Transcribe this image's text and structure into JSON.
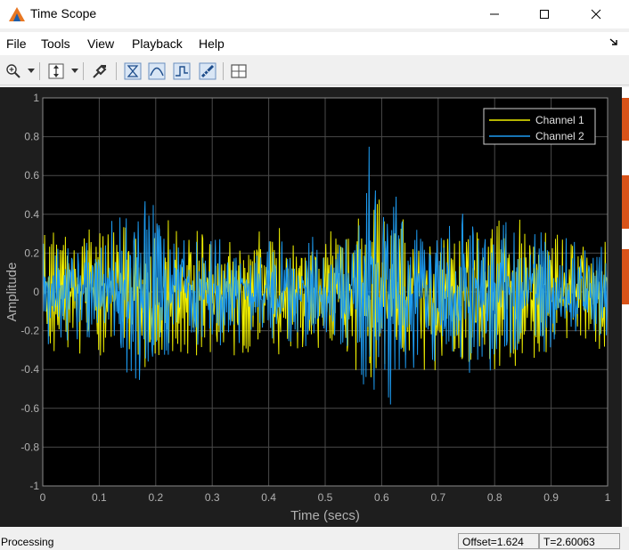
{
  "window": {
    "title": "Time Scope",
    "controls": [
      "minimize",
      "maximize",
      "close"
    ]
  },
  "menu": {
    "items": [
      "File",
      "Tools",
      "View",
      "Playback",
      "Help"
    ]
  },
  "toolbar": {
    "icons": [
      "zoom-in-icon",
      "scale-axes-icon",
      "configuration-properties-icon",
      "trigger-triggers-icon",
      "cursor-measurements-icon",
      "signal-statistics-icon",
      "peak-finder-icon",
      "layout-icon"
    ]
  },
  "scope": {
    "colors": {
      "background": "#000000",
      "figure": "#1e1e1e",
      "grid": "#4a4a4a",
      "axis_text": "#b0b0b0",
      "channel1": "#f0f000",
      "channel2": "#1d9bf0"
    }
  },
  "chart_data": {
    "type": "line",
    "xlabel": "Time (secs)",
    "ylabel": "Amplitude",
    "xlim": [
      0,
      1
    ],
    "ylim": [
      -1,
      1
    ],
    "xticks": [
      "0",
      "0.1",
      "0.2",
      "0.3",
      "0.4",
      "0.5",
      "0.6",
      "0.7",
      "0.8",
      "0.9",
      "1"
    ],
    "yticks": [
      "1",
      "0.8",
      "0.6",
      "0.4",
      "0.2",
      "0",
      "-0.2",
      "-0.4",
      "-0.6",
      "-0.8",
      "-1"
    ],
    "grid": true,
    "legend": "top-right",
    "series": [
      {
        "name": "Channel 1",
        "color": "#f0f000",
        "envelope_x": [
          0.0,
          0.1,
          0.15,
          0.2,
          0.3,
          0.4,
          0.5,
          0.55,
          0.58,
          0.6,
          0.62,
          0.65,
          0.7,
          0.75,
          0.8,
          0.9,
          1.0
        ],
        "envelope_amp": [
          0.35,
          0.35,
          0.4,
          0.4,
          0.35,
          0.35,
          0.3,
          0.4,
          0.55,
          0.5,
          0.42,
          0.4,
          0.42,
          0.45,
          0.42,
          0.35,
          0.32
        ]
      },
      {
        "name": "Channel 2",
        "color": "#1d9bf0",
        "envelope_x": [
          0.0,
          0.1,
          0.13,
          0.15,
          0.18,
          0.2,
          0.25,
          0.35,
          0.45,
          0.55,
          0.57,
          0.58,
          0.6,
          0.62,
          0.65,
          0.7,
          0.78,
          0.8,
          0.9,
          1.0
        ],
        "envelope_amp": [
          0.3,
          0.32,
          0.4,
          0.55,
          0.6,
          0.45,
          0.3,
          0.28,
          0.28,
          0.3,
          0.6,
          0.85,
          0.75,
          0.65,
          0.45,
          0.4,
          0.5,
          0.4,
          0.3,
          0.28
        ]
      }
    ]
  },
  "status": {
    "text": "Processing",
    "offset": "Offset=1.624",
    "time": "T=2.60063"
  }
}
